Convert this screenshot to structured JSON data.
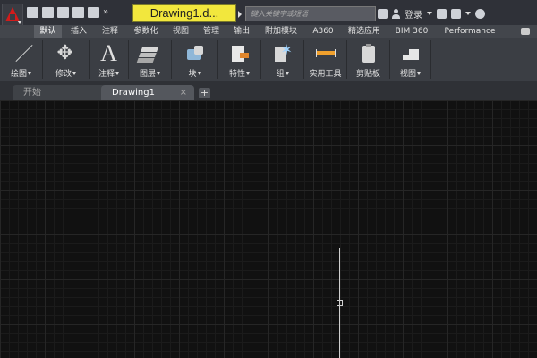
{
  "titlebar": {
    "document_title": "Drawing1.d...",
    "search_placeholder": "键入关键字或短语",
    "login_label": "登录"
  },
  "ribbon_tabs": [
    "默认",
    "插入",
    "注释",
    "参数化",
    "视图",
    "管理",
    "输出",
    "附加模块",
    "A360",
    "精选应用",
    "BIM 360",
    "Performance"
  ],
  "active_tab_index": 0,
  "panels": [
    {
      "label": "绘图",
      "icon": "line-icon",
      "has_dropdown": true
    },
    {
      "label": "修改",
      "icon": "move-icon",
      "has_dropdown": true
    },
    {
      "label": "注释",
      "icon": "text-icon",
      "has_dropdown": true
    },
    {
      "label": "图层",
      "icon": "layers-icon",
      "has_dropdown": true
    },
    {
      "label": "块",
      "icon": "block-icon",
      "has_dropdown": true
    },
    {
      "label": "特性",
      "icon": "properties-icon",
      "has_dropdown": true
    },
    {
      "label": "组",
      "icon": "group-icon",
      "has_dropdown": true
    },
    {
      "label": "实用工具",
      "icon": "utilities-icon",
      "has_dropdown": false
    },
    {
      "label": "剪贴板",
      "icon": "clipboard-icon",
      "has_dropdown": false
    },
    {
      "label": "视图",
      "icon": "view-icon",
      "has_dropdown": true
    }
  ],
  "file_tabs": {
    "start": "开始",
    "drawing": "Drawing1",
    "close_symbol": "×",
    "new_symbol": "+"
  },
  "colors": {
    "doc_title_bg": "#f2e73d",
    "canvas_bg": "#111111",
    "ribbon_bg": "#3b3e44",
    "app_logo": "#d21b1b"
  }
}
